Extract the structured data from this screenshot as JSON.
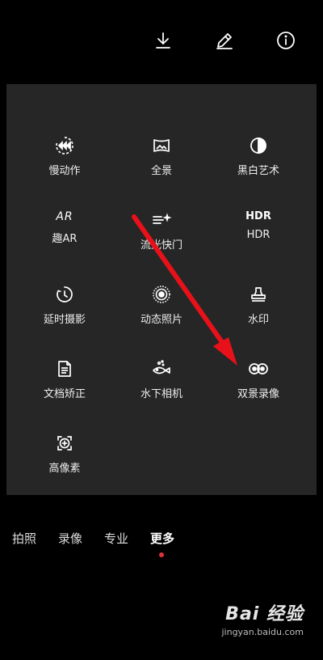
{
  "top_actions": [
    {
      "icon": "download-icon"
    },
    {
      "icon": "edit-pencil-icon"
    },
    {
      "icon": "info-icon"
    }
  ],
  "modes": [
    {
      "label": "慢动作",
      "icon": "slow-motion-icon"
    },
    {
      "label": "全景",
      "icon": "panorama-icon"
    },
    {
      "label": "黑白艺术",
      "icon": "monochrome-icon"
    },
    {
      "label": "趣AR",
      "icon": "ar-icon"
    },
    {
      "label": "流光快门",
      "icon": "light-painting-icon"
    },
    {
      "label": "HDR",
      "icon": "hdr-icon"
    },
    {
      "label": "延时摄影",
      "icon": "timelapse-icon"
    },
    {
      "label": "动态照片",
      "icon": "moving-picture-icon"
    },
    {
      "label": "水印",
      "icon": "watermark-stamp-icon"
    },
    {
      "label": "文档矫正",
      "icon": "document-icon"
    },
    {
      "label": "水下相机",
      "icon": "underwater-fish-icon"
    },
    {
      "label": "双景录像",
      "icon": "dual-view-icon"
    },
    {
      "label": "高像素",
      "icon": "high-resolution-icon"
    }
  ],
  "hdr_icon_text": "HDR",
  "ar_icon_text": "AR",
  "tabs": [
    {
      "label": "拍照"
    },
    {
      "label": "录像"
    },
    {
      "label": "专业"
    },
    {
      "label": "更多",
      "active": true
    }
  ],
  "accent_color": "#e0313a",
  "annotation_arrow_color": "#e8111a",
  "watermark": {
    "brand": "Bai 经验",
    "url": "jingyan.baidu.com"
  }
}
